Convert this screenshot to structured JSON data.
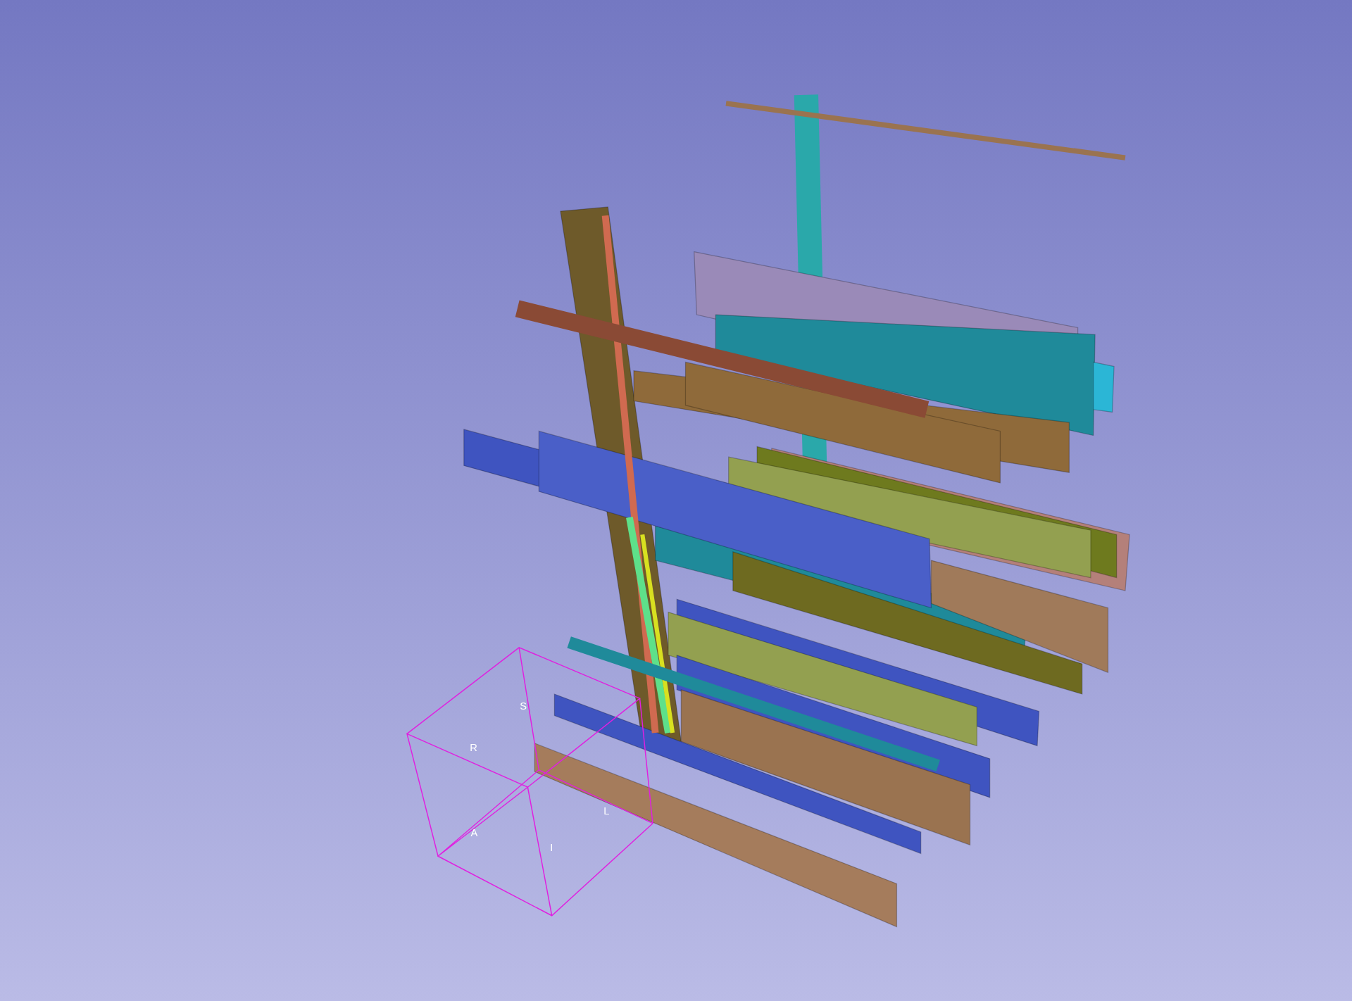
{
  "view": {
    "orientation_labels": [
      {
        "text": "S",
        "kind": "superior"
      },
      {
        "text": "R",
        "kind": "right"
      },
      {
        "text": "L",
        "kind": "left"
      },
      {
        "text": "A",
        "kind": "anterior"
      },
      {
        "text": "I",
        "kind": "inferior"
      }
    ]
  }
}
